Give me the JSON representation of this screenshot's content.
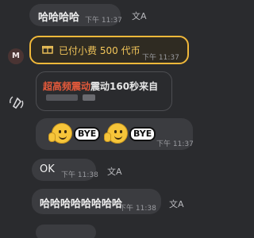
{
  "messages": [
    {
      "text": "哈哈哈哈",
      "time": "下午 11:37"
    },
    {
      "text": "OK",
      "time": "下午 11:38"
    },
    {
      "text": "哈哈哈哈哈哈哈哈",
      "time": "下午 11:38"
    }
  ],
  "avatar_letter": "M",
  "tip": {
    "paid": "已付小费",
    "amount": "500 代币",
    "time": "下午 11:37"
  },
  "shake": {
    "prefix": "超高频震动",
    "middle": "震动",
    "seconds": "160秒",
    "suffix": "来自"
  },
  "stickers": {
    "label1": "BYE",
    "label2": "BYE",
    "time": "下午 11:37"
  },
  "icons": [
    "translate-icon",
    "gift-icon",
    "shake-icon",
    "avatar"
  ],
  "colors": {
    "background": "#2a2b2e",
    "bubble": "#3b3c40",
    "tip_border": "#f0b83a",
    "shake_accent": "#e55a3b"
  }
}
